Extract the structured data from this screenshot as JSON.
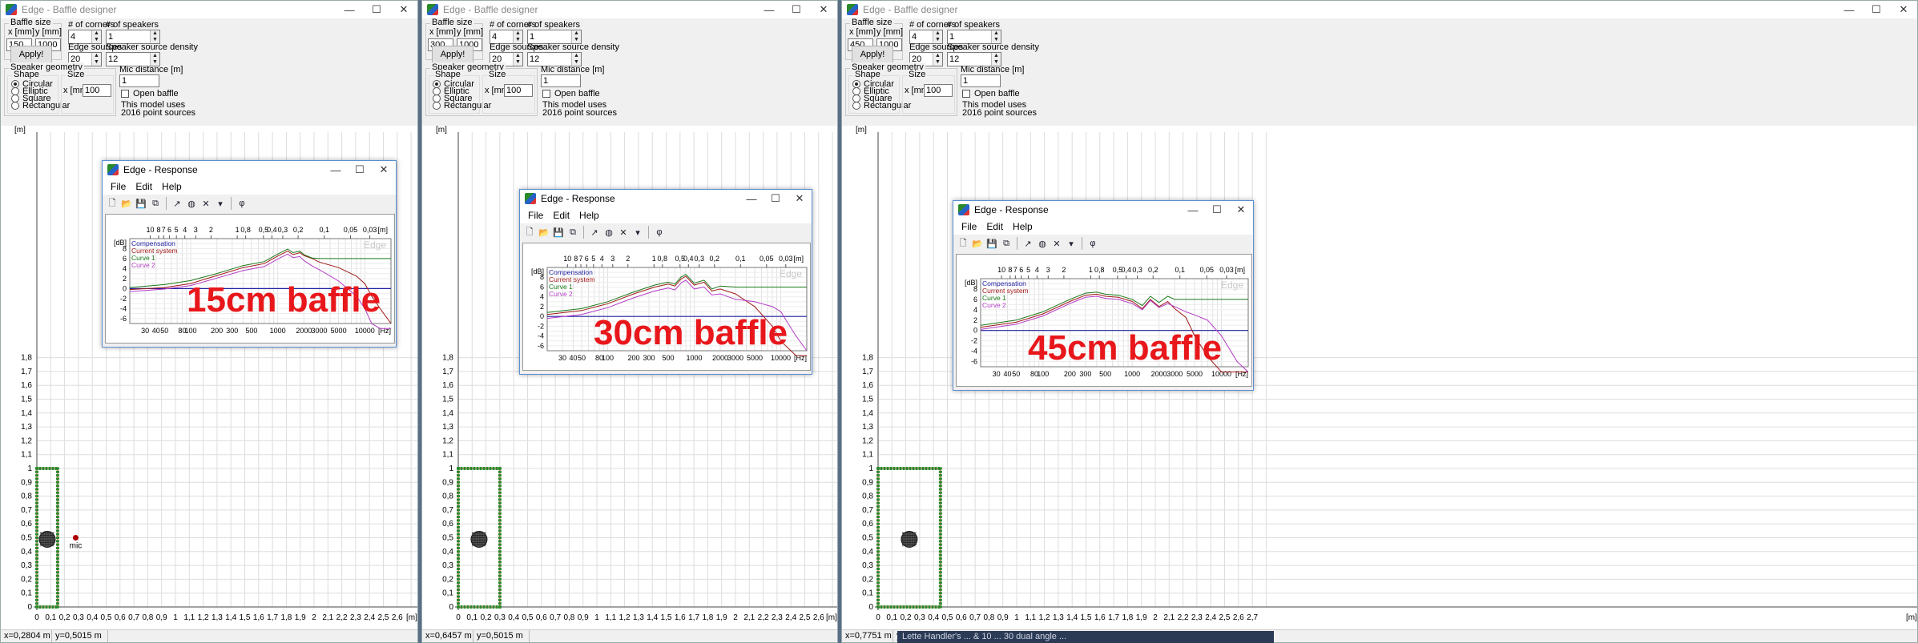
{
  "windows": [
    {
      "title": "Edge - Baffle designer",
      "baffle_x": "150",
      "baffle_y": "1000",
      "corners": "4",
      "speakers": "1",
      "edge_sources": "20",
      "speaker_density": "12",
      "size_x": "100",
      "mic": "1",
      "status_x": "x=0,2804 m",
      "status_y": "y=0,5015 m",
      "caption": "15cm baffle",
      "baffle_w_m": 0.15
    },
    {
      "title": "Edge - Baffle designer",
      "baffle_x": "300",
      "baffle_y": "1000",
      "corners": "4",
      "speakers": "1",
      "edge_sources": "20",
      "speaker_density": "12",
      "size_x": "100",
      "mic": "1",
      "status_x": "x=0,6457 m",
      "status_y": "y=0,5015 m",
      "caption": "30cm baffle",
      "baffle_w_m": 0.3
    },
    {
      "title": "Edge - Baffle designer",
      "baffle_x": "450",
      "baffle_y": "1000",
      "corners": "4",
      "speakers": "1",
      "edge_sources": "20",
      "speaker_density": "12",
      "size_x": "100",
      "mic": "1",
      "status_x": "x=0,7751 m",
      "status_y": "y=0,4977 m",
      "caption": "45cm baffle",
      "baffle_w_m": 0.45
    }
  ],
  "labels": {
    "baffle_size": "Baffle size",
    "x_mm": "x [mm]",
    "y_mm": "y [mm]",
    "apply": "Apply!",
    "corners": "# of corners",
    "speakers": "# of speakers",
    "edge_sources": "Edge sources",
    "speaker_density": "Speaker source density",
    "speaker_geometry": "Speaker geometry",
    "shape": "Shape",
    "size": "Size",
    "mic_distance": "Mic distance [m]",
    "open_baffle": "Open baffle",
    "model_uses": "This model uses",
    "point_sources": "2016 point sources",
    "shapes": [
      "Circular",
      "Elliptic",
      "Square",
      "Rectangular"
    ],
    "mic": "mic",
    "m_unit": "[m]"
  },
  "response": {
    "title": "Edge - Response",
    "menu": [
      "File",
      "Edit",
      "Help"
    ],
    "watermark": "Edge",
    "db_label": "[dB]",
    "hz_label": "[Hz]",
    "m_label": "[m]",
    "legend": [
      "Compensation",
      "Current system",
      "Curve 1",
      "Curve 2"
    ],
    "colors": [
      "#1f1fa0",
      "#a11818",
      "#1a7a1a",
      "#b43cc8"
    ]
  },
  "taskbar_text": "Lette Handler's ... & 10 ... 30 dual angle ...",
  "chart_data": [
    {
      "type": "line",
      "title": "15cm baffle",
      "xlabel": "[Hz]",
      "ylabel": "[dB]",
      "ylim": [
        -7,
        10
      ],
      "xlim": [
        20,
        20000
      ],
      "x_scale": "log",
      "top_axis_labels": [
        "10",
        "8",
        "7",
        "6",
        "5",
        "4",
        "3",
        "2",
        "1",
        "0,8",
        "0,5",
        "0,4",
        "0,3",
        "0,2",
        "0,1",
        "0,05",
        "0,03"
      ],
      "y_ticks": [
        8,
        6,
        4,
        2,
        0,
        -2,
        -4,
        -6
      ],
      "x_ticks": [
        "30",
        "40",
        "50",
        "80",
        "100",
        "200",
        "300",
        "500",
        "1000",
        "2000",
        "3000",
        "5000",
        "10000"
      ],
      "x": [
        20,
        50,
        100,
        200,
        400,
        700,
        1000,
        1300,
        1500,
        1800,
        2000,
        2500,
        3000,
        5000,
        8000,
        10000,
        12000,
        15000,
        20000
      ],
      "series": [
        {
          "name": "Compensation",
          "values": [
            0,
            0,
            0,
            0,
            0,
            0,
            0,
            0,
            0,
            0,
            0,
            0,
            0,
            0,
            0,
            0,
            0,
            0,
            0
          ]
        },
        {
          "name": "Current system",
          "values": [
            -0.2,
            0.2,
            1,
            2.6,
            4.2,
            5,
            6.5,
            7.5,
            6.8,
            7.2,
            6.6,
            6,
            5.3,
            4.2,
            2.5,
            1,
            -1.5,
            -4,
            -7
          ]
        },
        {
          "name": "Curve 1",
          "values": [
            0.2,
            0.8,
            1.6,
            3,
            4.6,
            5.4,
            6.9,
            7.9,
            7.2,
            7.5,
            6.8,
            6.1,
            6,
            6,
            6,
            6,
            6,
            6,
            6
          ]
        },
        {
          "name": "Curve 2",
          "values": [
            -0.6,
            -0.1,
            0.6,
            2.1,
            3.6,
            4.4,
            5.9,
            6.9,
            6.2,
            6.4,
            5.6,
            4.5,
            3.8,
            1.5,
            -1.5,
            -4,
            -7,
            -8,
            -8
          ]
        }
      ]
    },
    {
      "type": "line",
      "title": "30cm baffle",
      "xlabel": "[Hz]",
      "ylabel": "[dB]",
      "ylim": [
        -7,
        10
      ],
      "xlim": [
        20,
        20000
      ],
      "x_scale": "log",
      "top_axis_labels": [
        "10",
        "8",
        "7",
        "6",
        "5",
        "4",
        "3",
        "2",
        "1",
        "0,8",
        "0,5",
        "0,4",
        "0,3",
        "0,2",
        "0,1",
        "0,05",
        "0,03"
      ],
      "y_ticks": [
        8,
        6,
        4,
        2,
        0,
        -2,
        -4,
        -6
      ],
      "x_ticks": [
        "30",
        "40",
        "50",
        "80",
        "100",
        "200",
        "300",
        "500",
        "1000",
        "2000",
        "3000",
        "5000",
        "10000"
      ],
      "x": [
        20,
        50,
        100,
        200,
        350,
        500,
        600,
        700,
        800,
        1000,
        1300,
        1600,
        2000,
        3000,
        5000,
        8000,
        10000,
        15000,
        20000
      ],
      "series": [
        {
          "name": "Compensation",
          "values": [
            0,
            0,
            0,
            0,
            0,
            0,
            0,
            0,
            0,
            0,
            0,
            0,
            0,
            0,
            0,
            0,
            0,
            0,
            0
          ]
        },
        {
          "name": "Current system",
          "values": [
            0.4,
            1.2,
            2.6,
            4.6,
            6,
            6.6,
            6.2,
            7.6,
            8.2,
            6.4,
            7,
            5.2,
            5.6,
            4.6,
            2,
            -2,
            -5,
            -8,
            -8
          ]
        },
        {
          "name": "Curve 1",
          "values": [
            0.8,
            1.6,
            3,
            5,
            6.4,
            7,
            6.6,
            8,
            8.6,
            6.8,
            7.4,
            5.6,
            6.2,
            6,
            6,
            6,
            6,
            6,
            6
          ]
        },
        {
          "name": "Curve 2",
          "values": [
            -0.4,
            0.4,
            1.8,
            3.8,
            5.2,
            5.8,
            5.4,
            6.8,
            7.4,
            5.6,
            6,
            4.4,
            4.6,
            3.5,
            3,
            2,
            1,
            -4,
            -7
          ]
        }
      ]
    },
    {
      "type": "line",
      "title": "45cm baffle",
      "xlabel": "[Hz]",
      "ylabel": "[dB]",
      "ylim": [
        -7,
        10
      ],
      "xlim": [
        20,
        20000
      ],
      "x_scale": "log",
      "top_axis_labels": [
        "10",
        "8",
        "7",
        "6",
        "5",
        "4",
        "3",
        "2",
        "1",
        "0,8",
        "0,5",
        "0,4",
        "0,3",
        "0,2",
        "0,1",
        "0,05",
        "0,03"
      ],
      "y_ticks": [
        8,
        6,
        4,
        2,
        0,
        -2,
        -4,
        -6
      ],
      "x_ticks": [
        "30",
        "40",
        "50",
        "80",
        "100",
        "200",
        "300",
        "500",
        "1000",
        "2000",
        "3000",
        "5000",
        "10000"
      ],
      "x": [
        20,
        50,
        100,
        200,
        300,
        400,
        500,
        700,
        1000,
        1300,
        1600,
        2000,
        2500,
        3000,
        4000,
        5000,
        7000,
        10000,
        15000,
        20000
      ],
      "series": [
        {
          "name": "Compensation",
          "values": [
            0,
            0,
            0,
            0,
            0,
            0,
            0,
            0,
            0,
            0,
            0,
            0,
            0,
            0,
            0,
            0,
            0,
            0,
            0,
            0
          ]
        },
        {
          "name": "Current system",
          "values": [
            0.6,
            1.6,
            3.2,
            5.6,
            6.8,
            7,
            6.6,
            6.4,
            5.6,
            4.2,
            6,
            4.6,
            5.6,
            4.2,
            2.5,
            -1,
            -5,
            -8,
            -8,
            -8
          ]
        },
        {
          "name": "Curve 1",
          "values": [
            1,
            2,
            3.6,
            6,
            7.2,
            7.4,
            7,
            6.8,
            6,
            4.8,
            6.6,
            5.4,
            6.6,
            6,
            6,
            6,
            6,
            6,
            6,
            6
          ]
        },
        {
          "name": "Curve 2",
          "values": [
            0.2,
            1.2,
            2.8,
            5.2,
            6.4,
            6.6,
            6.2,
            6,
            5.2,
            4,
            5.8,
            4.4,
            5.2,
            4.6,
            3.6,
            3,
            2,
            -1,
            -6,
            -8
          ]
        }
      ]
    }
  ]
}
